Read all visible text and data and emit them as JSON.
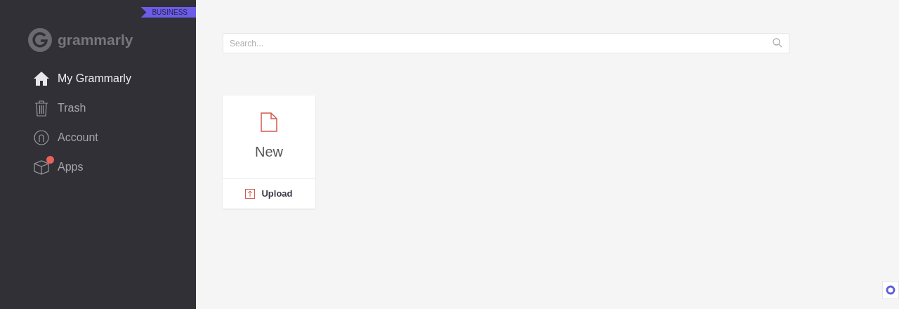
{
  "sidebar": {
    "badge": "BUSINESS",
    "logo": "grammarly",
    "items": [
      {
        "label": "My Grammarly",
        "kind": "home",
        "selected": true,
        "notification": false
      },
      {
        "label": "Trash",
        "kind": "trash",
        "selected": false,
        "notification": false
      },
      {
        "label": "Account",
        "kind": "account",
        "selected": false,
        "notification": false
      },
      {
        "label": "Apps",
        "kind": "apps",
        "selected": false,
        "notification": true
      }
    ]
  },
  "search": {
    "placeholder": "Search..."
  },
  "new_card": {
    "label": "New",
    "upload": "Upload"
  }
}
